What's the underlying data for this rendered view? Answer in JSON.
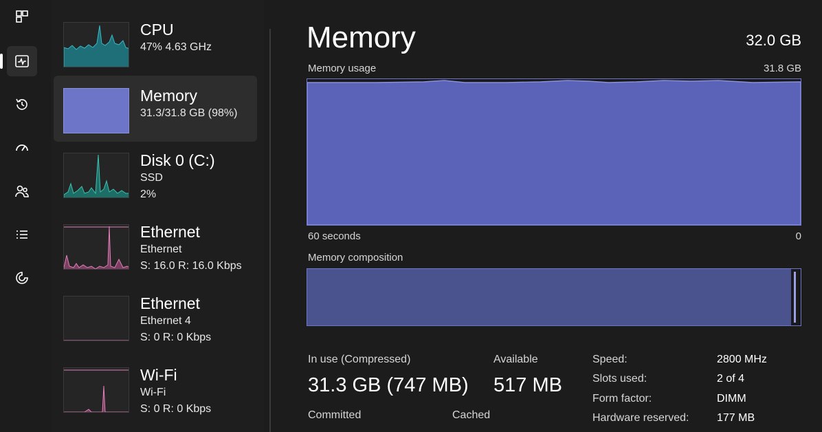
{
  "rail": {
    "items": [
      {
        "name": "processes-icon"
      },
      {
        "name": "performance-icon"
      },
      {
        "name": "app-history-icon"
      },
      {
        "name": "startup-apps-icon"
      },
      {
        "name": "users-icon"
      },
      {
        "name": "details-icon"
      },
      {
        "name": "services-icon"
      }
    ]
  },
  "resources": [
    {
      "title": "CPU",
      "line1": "47% 4.63 GHz",
      "line2": "",
      "line3": "",
      "color": "#38b8c6"
    },
    {
      "title": "Memory",
      "line1": "31.3/31.8 GB (98%)",
      "line2": "",
      "line3": "",
      "color": "#6d75c8"
    },
    {
      "title": "Disk 0 (C:)",
      "line1": "SSD",
      "line2": "2%",
      "line3": "",
      "color": "#3fc0b0"
    },
    {
      "title": "Ethernet",
      "line1": "Ethernet",
      "line2": "S: 16.0 R: 16.0 Kbps",
      "line3": "",
      "color": "#e07fb8"
    },
    {
      "title": "Ethernet",
      "line1": "Ethernet 4",
      "line2": "S: 0 R: 0 Kbps",
      "line3": "",
      "color": "#e07fb8"
    },
    {
      "title": "Wi-Fi",
      "line1": "Wi-Fi",
      "line2": "S: 0 R: 0 Kbps",
      "line3": "",
      "color": "#e07fb8"
    }
  ],
  "main": {
    "title": "Memory",
    "total": "32.0 GB",
    "usage_label": "Memory usage",
    "usage_max": "31.8 GB",
    "time_label": "60 seconds",
    "zero_label": "0",
    "composition_label": "Memory composition",
    "in_use_label": "In use (Compressed)",
    "in_use_value": "31.3 GB (747 MB)",
    "available_label": "Available",
    "available_value": "517 MB",
    "committed_label": "Committed",
    "cached_label": "Cached",
    "specs": [
      {
        "key": "Speed:",
        "value": "2800 MHz"
      },
      {
        "key": "Slots used:",
        "value": "2 of 4"
      },
      {
        "key": "Form factor:",
        "value": "DIMM"
      },
      {
        "key": "Hardware reserved:",
        "value": "177 MB"
      }
    ],
    "accent": "#6d75c8",
    "usage_fraction": 0.98
  }
}
